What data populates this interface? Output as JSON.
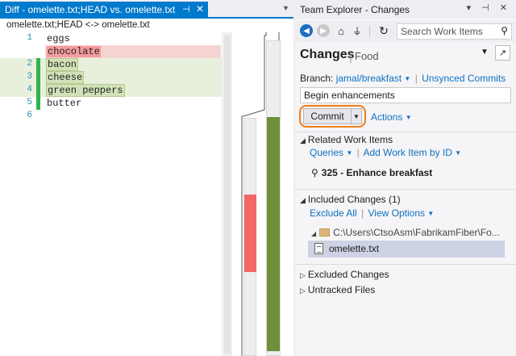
{
  "diff": {
    "tab_title": "Diff - omelette.txt;HEAD vs. omelette.txt",
    "tab_pin_glyph": "⊣",
    "tab_close_glyph": "✕",
    "dropdown_glyph": "▼",
    "path": "omelette.txt;HEAD <-> omelette.txt",
    "lines": [
      {
        "num": "1",
        "text": "eggs",
        "kind": "normal"
      },
      {
        "num": "",
        "text": "chocolate",
        "kind": "removed"
      },
      {
        "num": "2",
        "text": "bacon",
        "kind": "added"
      },
      {
        "num": "3",
        "text": "cheese",
        "kind": "added"
      },
      {
        "num": "4",
        "text": "green peppers",
        "kind": "added"
      },
      {
        "num": "5",
        "text": "butter",
        "kind": "normal"
      },
      {
        "num": "6",
        "text": "",
        "kind": "normal"
      }
    ]
  },
  "team_explorer": {
    "title": "Team Explorer - Changes",
    "title_buttons": "▾ ⊣ ✕",
    "search_placeholder": "Search Work Items",
    "page_title": "Changes",
    "page_separator": "|",
    "page_subtitle": "Food",
    "branch_label": "Branch:",
    "branch_name": "jamal/breakfast",
    "unsynced_link": "Unsynced Commits",
    "commit_message": "Begin enhancements",
    "commit_label": "Commit",
    "actions_label": "Actions",
    "related": {
      "heading": "Related Work Items",
      "queries": "Queries",
      "add_work_item": "Add Work Item by ID",
      "work_item": "325 - Enhance breakfast"
    },
    "included": {
      "heading": "Included Changes (1)",
      "exclude_all": "Exclude All",
      "view_options": "View Options",
      "folder": "C:\\Users\\CtsoAsm\\FabrikamFiber\\Fo...",
      "file": "omelette.txt"
    },
    "excluded_heading": "Excluded Changes",
    "untracked_heading": "Untracked Files"
  },
  "colors": {
    "accent": "#007acc",
    "link": "#0e70c0",
    "removed": "#f59b9b",
    "added": "#d2e2b8",
    "highlight_ring": "#f07d1b"
  }
}
